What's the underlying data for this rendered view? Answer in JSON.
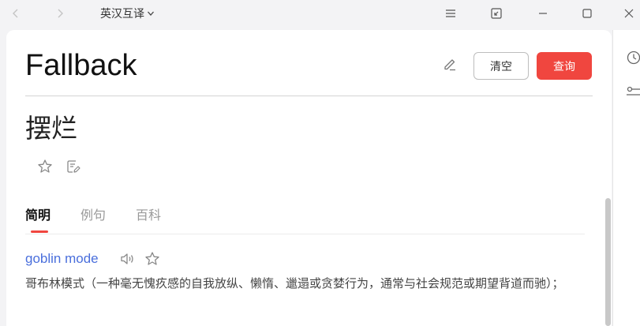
{
  "titlebar": {
    "mode_label": "英汉互译",
    "back_icon": "chevron-left-icon",
    "forward_icon": "chevron-right-icon",
    "dropdown_icon": "chevron-down-icon",
    "window_buttons": [
      "menu-icon",
      "mini-window-icon",
      "minimize-icon",
      "maximize-icon",
      "close-icon"
    ]
  },
  "query": {
    "word": "Fallback",
    "clear_label": "清空",
    "search_label": "查询"
  },
  "result": {
    "word": "摆烂"
  },
  "tabs": [
    {
      "label": "简明",
      "active": true
    },
    {
      "label": "例句",
      "active": false
    },
    {
      "label": "百科",
      "active": false
    }
  ],
  "entry": {
    "term": "goblin mode",
    "definition": "哥布林模式（一种毫无愧疚感的自我放纵、懒惰、邋遢或贪婪行为，通常与社会规范或期望背道而驰）；"
  },
  "sidebar": {
    "icons": [
      "history-icon",
      "settings-icon"
    ]
  },
  "colors": {
    "accent": "#f0463f",
    "link": "#4a6fdc",
    "background": "#f3f3f5"
  }
}
